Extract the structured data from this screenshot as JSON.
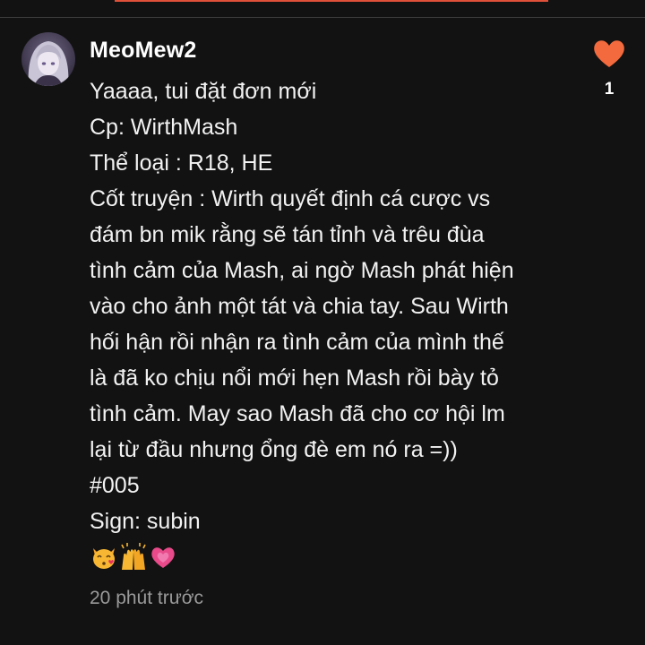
{
  "comment": {
    "username": "MeoMew2",
    "avatar_icon": "anime-girl-avatar-icon",
    "lines": [
      "Yaaaa, tui đặt đơn mới",
      "Cp: WirthMash",
      "Thể loại : R18, HE",
      "Cốt truyện : Wirth quyết định cá cược vs",
      "đám bn mik rằng sẽ tán tỉnh và trêu đùa",
      "tình cảm của Mash, ai ngờ Mash phát hiện",
      "vào cho ảnh một tát và chia tay. Sau Wirth",
      "hối hận rồi nhận ra tình cảm của mình thế",
      "là đã ko chịu nổi mới hẹn Mash rồi bày tỏ",
      "tình cảm. May sao Mash đã cho cơ hội lm",
      "lại từ đầu nhưng ổng đè em nó ra =))",
      "#005",
      "Sign: subin"
    ],
    "emojis": [
      "kissing-cat-emoji",
      "raising-hands-emoji",
      "growing-heart-emoji"
    ],
    "timestamp": "20 phút trước",
    "like": {
      "icon": "heart-icon",
      "count": "1",
      "color": "#f26a3d"
    }
  },
  "colors": {
    "background": "#121212",
    "accent": "#e0513a",
    "timestamp": "#9a9a9a"
  }
}
